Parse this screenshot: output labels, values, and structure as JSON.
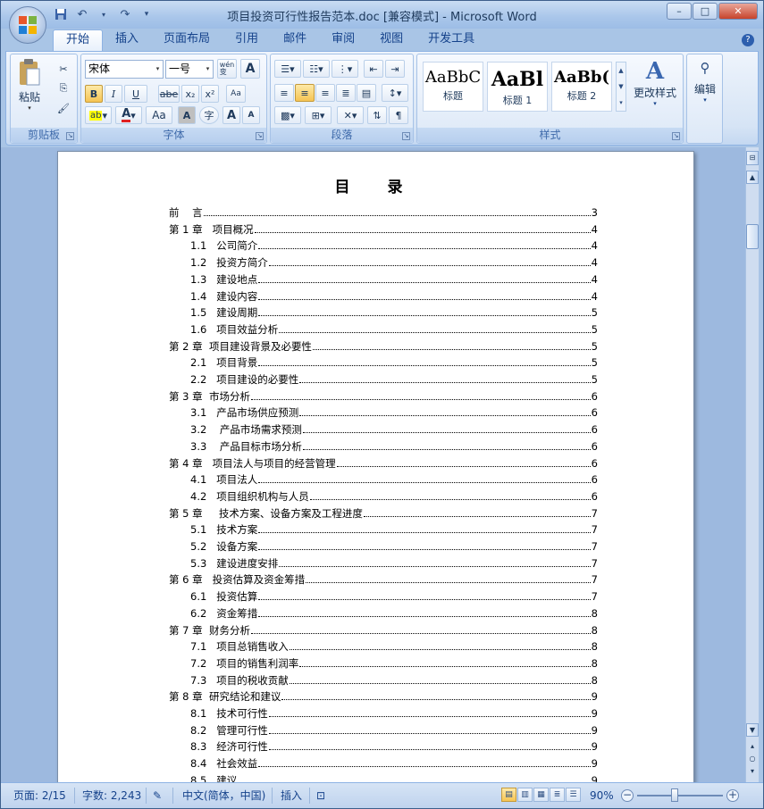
{
  "window": {
    "title": "项目投资可行性报告范本.doc [兼容模式] - Microsoft Word",
    "minimize": "–",
    "maximize": "□",
    "close": "✕"
  },
  "qat": {
    "save": "💾",
    "undo": "↶",
    "redo": "↷",
    "more": "▾"
  },
  "tabs": [
    "开始",
    "插入",
    "页面布局",
    "引用",
    "邮件",
    "审阅",
    "视图",
    "开发工具"
  ],
  "help": "?",
  "clipboard": {
    "paste": "粘贴",
    "label": "剪贴板"
  },
  "font": {
    "name": "宋体",
    "size": "一号",
    "wen": "wén\n变",
    "label": "字体",
    "bold": "B",
    "italic": "I",
    "underline": "U",
    "strike": "abe",
    "sub": "x₂",
    "sup": "x²",
    "highlight": "ab",
    "fontcolor": "A",
    "case": "Aa",
    "charshade": "A",
    "enclose": "字",
    "grow": "A",
    "shrink": "A"
  },
  "paragraph": {
    "label": "段落"
  },
  "styles": {
    "label": "样式",
    "items": [
      {
        "sample": "AaBbC",
        "name": "标题"
      },
      {
        "sample": "AaBl",
        "name": "标题 1"
      },
      {
        "sample": "AaBb(",
        "name": "标题 2"
      }
    ],
    "change": "更改样式"
  },
  "edit": {
    "label": "编辑"
  },
  "document": {
    "toc_title": "目 录",
    "toc": [
      {
        "text": "前    言",
        "page": "3",
        "indent": 0
      },
      {
        "text": "第 1 章   项目概况",
        "page": "4",
        "indent": 0
      },
      {
        "text": "1.1   公司简介",
        "page": "4",
        "indent": 1
      },
      {
        "text": "1.2   投资方简介",
        "page": "4",
        "indent": 1
      },
      {
        "text": "1.3   建设地点",
        "page": "4",
        "indent": 1
      },
      {
        "text": "1.4   建设内容",
        "page": "4",
        "indent": 1
      },
      {
        "text": "1.5   建设周期",
        "page": "5",
        "indent": 1
      },
      {
        "text": "1.6   项目效益分析",
        "page": "5",
        "indent": 1
      },
      {
        "text": "第 2 章  项目建设背景及必要性",
        "page": "5",
        "indent": 0
      },
      {
        "text": "2.1   项目背景",
        "page": "5",
        "indent": 1
      },
      {
        "text": "2.2   项目建设的必要性",
        "page": "5",
        "indent": 1
      },
      {
        "text": "第 3 章  市场分析",
        "page": "6",
        "indent": 0
      },
      {
        "text": "3.1   产品市场供应预测",
        "page": "6",
        "indent": 1
      },
      {
        "text": "3.2    产品市场需求预测",
        "page": "6",
        "indent": 1
      },
      {
        "text": "3.3    产品目标市场分析",
        "page": "6",
        "indent": 1
      },
      {
        "text": "第 4 章   项目法人与项目的经营管理",
        "page": "6",
        "indent": 0
      },
      {
        "text": "4.1   项目法人",
        "page": "6",
        "indent": 1
      },
      {
        "text": "4.2   项目组织机构与人员",
        "page": "6",
        "indent": 1
      },
      {
        "text": "第 5 章     技术方案、设备方案及工程进度",
        "page": "7",
        "indent": 0
      },
      {
        "text": "5.1   技术方案",
        "page": "7",
        "indent": 1
      },
      {
        "text": "5.2   设备方案",
        "page": "7",
        "indent": 1
      },
      {
        "text": "5.3   建设进度安排",
        "page": "7",
        "indent": 1
      },
      {
        "text": "第 6 章   投资估算及资金筹措",
        "page": "7",
        "indent": 0
      },
      {
        "text": "6.1   投资估算",
        "page": "7",
        "indent": 1
      },
      {
        "text": "6.2   资金筹措",
        "page": "8",
        "indent": 1
      },
      {
        "text": "第 7 章  财务分析",
        "page": "8",
        "indent": 0
      },
      {
        "text": "7.1   项目总销售收入",
        "page": "8",
        "indent": 1
      },
      {
        "text": "7.2   项目的销售利润率",
        "page": "8",
        "indent": 1
      },
      {
        "text": "7.3   项目的税收贡献",
        "page": "8",
        "indent": 1
      },
      {
        "text": "第 8 章  研究结论和建议",
        "page": "9",
        "indent": 0
      },
      {
        "text": "8.1   技术可行性",
        "page": "9",
        "indent": 1
      },
      {
        "text": "8.2   管理可行性",
        "page": "9",
        "indent": 1
      },
      {
        "text": "8.3   经济可行性",
        "page": "9",
        "indent": 1
      },
      {
        "text": "8.4   社会效益",
        "page": "9",
        "indent": 1
      },
      {
        "text": "8.5   建议",
        "page": "9",
        "indent": 1
      }
    ]
  },
  "status": {
    "page": "页面: 2/15",
    "words": "字数: 2,243",
    "language": "中文(简体，中国)",
    "mode": "插入",
    "zoom": "90%"
  }
}
